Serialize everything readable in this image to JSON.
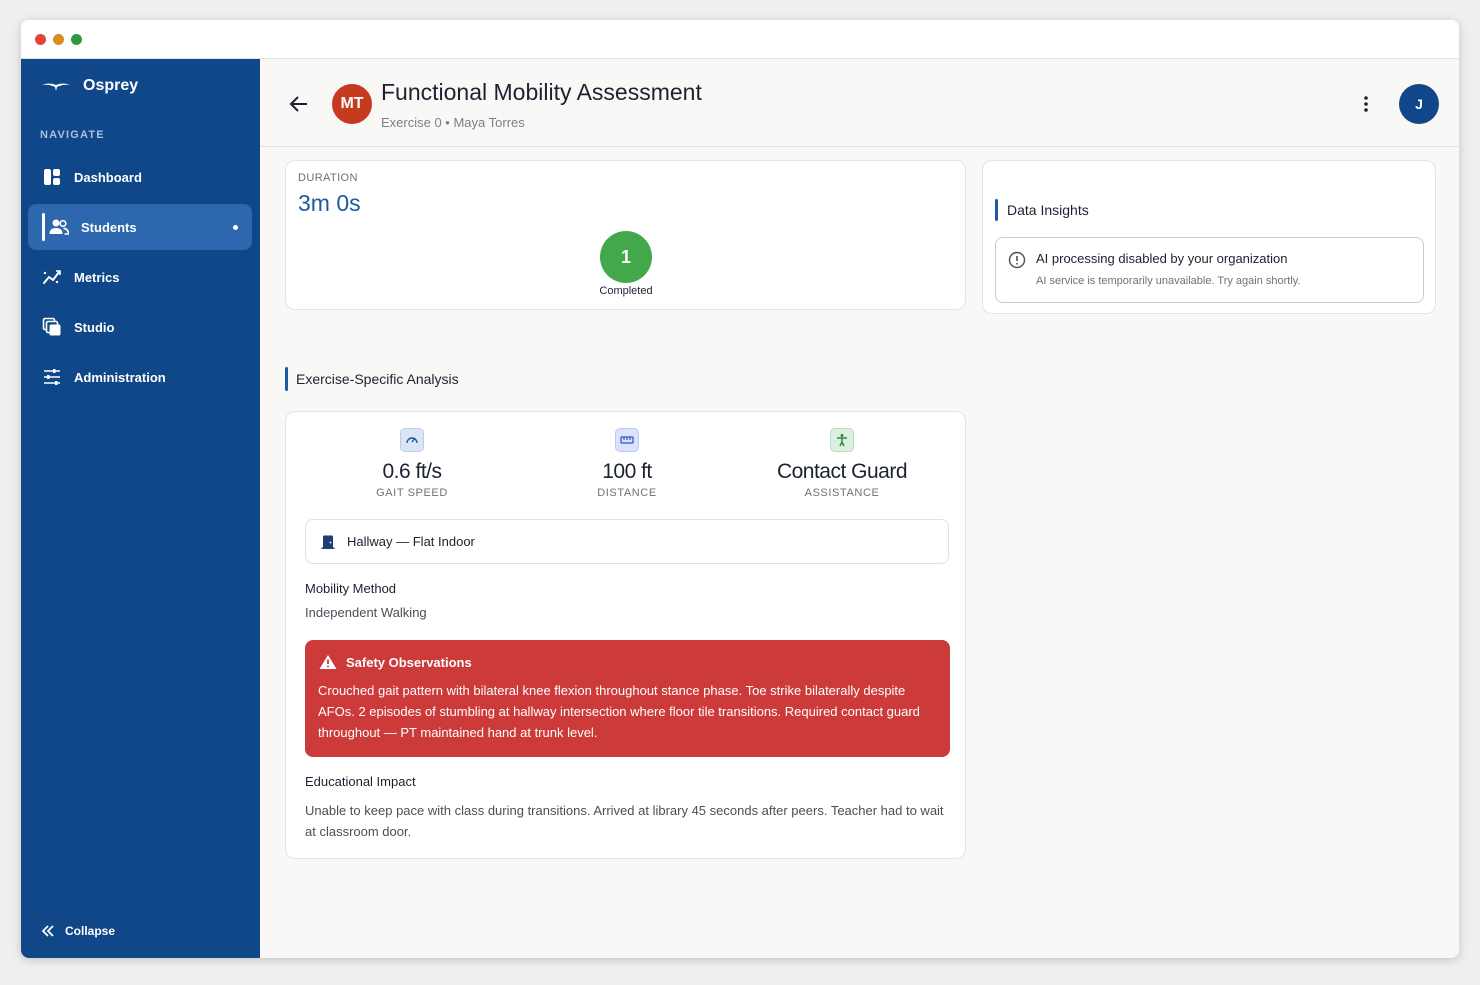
{
  "sidebar": {
    "brand": "Osprey",
    "nav_heading": "NAVIGATE",
    "items": [
      {
        "label": "Dashboard",
        "icon": "dashboard-icon"
      },
      {
        "label": "Students",
        "icon": "users-icon",
        "active": true
      },
      {
        "label": "Metrics",
        "icon": "metrics-icon"
      },
      {
        "label": "Studio",
        "icon": "studio-icon"
      },
      {
        "label": "Administration",
        "icon": "sliders-icon"
      }
    ],
    "collapse_label": "Collapse"
  },
  "header": {
    "avatar_initials": "MT",
    "title": "Functional Mobility Assessment",
    "subtitle": "Exercise 0 • Maya Torres",
    "user_initial": "J"
  },
  "duration": {
    "label": "DURATION",
    "value": "3m 0s",
    "completed_count": "1",
    "completed_label": "Completed"
  },
  "insights": {
    "title": "Data Insights",
    "notice_title": "AI processing disabled by your organization",
    "notice_text": "AI service is temporarily unavailable. Try again shortly."
  },
  "analysis": {
    "heading": "Exercise-Specific Analysis",
    "metrics": [
      {
        "value": "0.6 ft/s",
        "label": "GAIT SPEED",
        "icon": "speedometer-icon"
      },
      {
        "value": "100 ft",
        "label": "DISTANCE",
        "icon": "ruler-icon"
      },
      {
        "value": "Contact Guard",
        "label": "ASSISTANCE",
        "icon": "accessibility-icon"
      }
    ],
    "location": "Hallway — Flat Indoor",
    "mobility_method_title": "Mobility Method",
    "mobility_method_value": "Independent Walking",
    "safety_title": "Safety Observations",
    "safety_text": "Crouched gait pattern with bilateral knee flexion throughout stance phase. Toe strike bilaterally despite AFOs. 2 episodes of stumbling at hallway intersection where floor tile transitions. Required contact guard throughout — PT maintained hand at trunk level.",
    "educational_impact_title": "Educational Impact",
    "educational_impact_text": "Unable to keep pace with class during transitions. Arrived at library 45 seconds after peers. Teacher had to wait at classroom door."
  },
  "colors": {
    "sidebar": "#0f4788",
    "accent": "#1d5aa2",
    "completed": "#43a84b",
    "danger": "#cd3a3a",
    "avatar_mt": "#c63a1e"
  }
}
